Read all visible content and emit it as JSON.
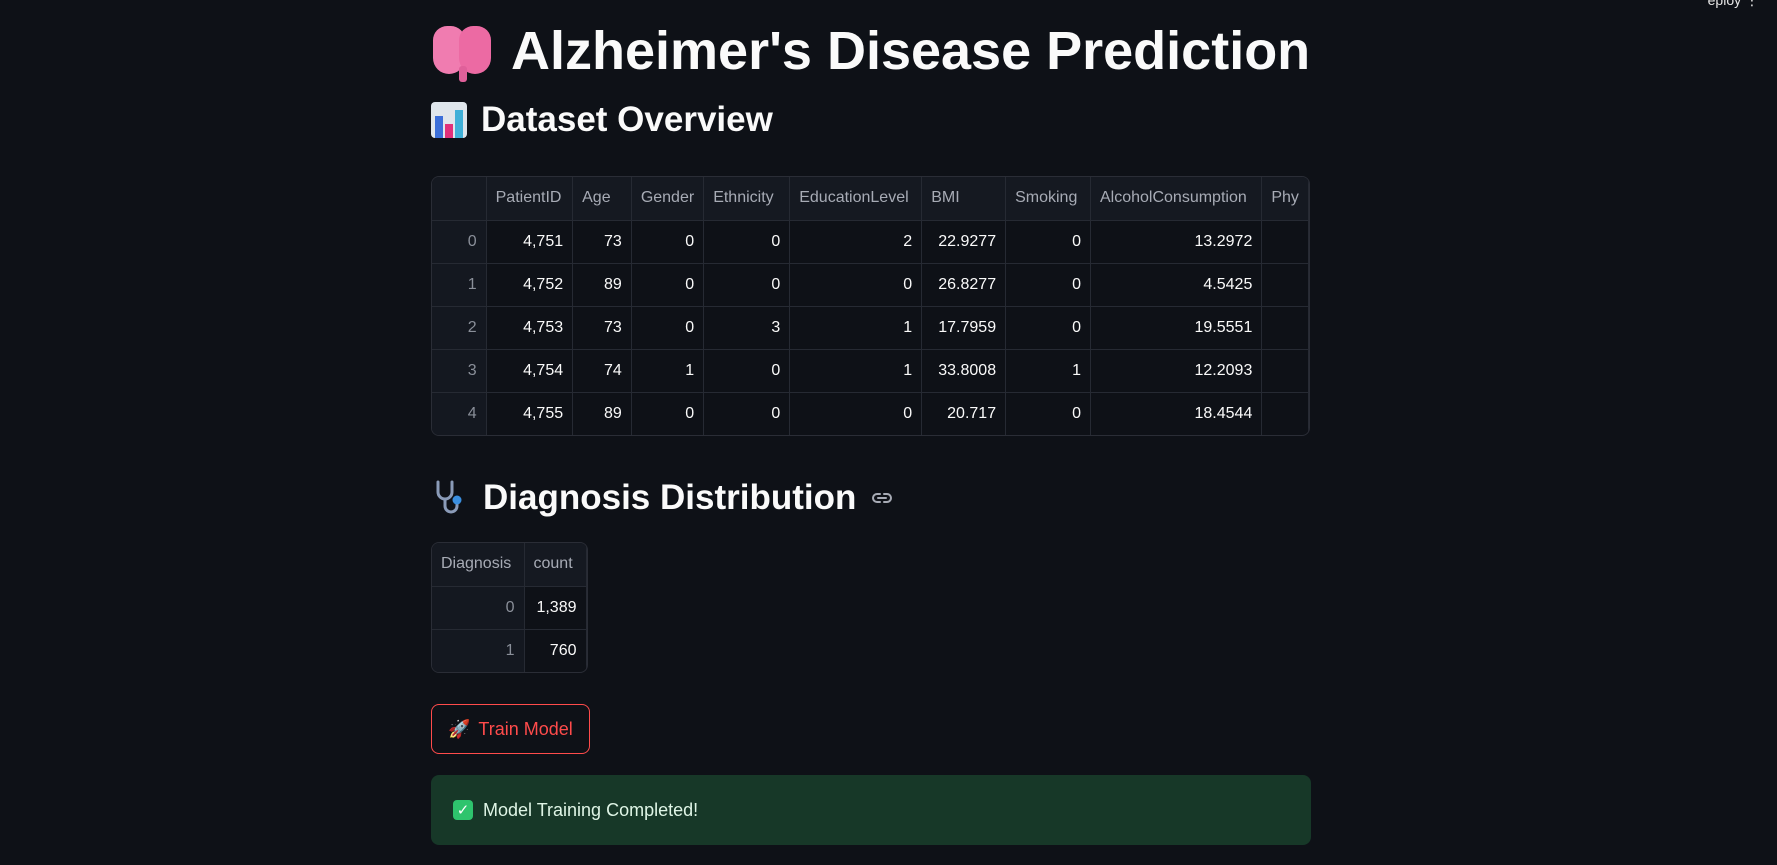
{
  "top_right_fragment": "eploy ⋮",
  "title": "Alzheimer's Disease Prediction",
  "title_icon": "brain-icon",
  "dataset_section": {
    "heading": "Dataset Overview",
    "icon": "bar-chart-icon",
    "columns": [
      "",
      "PatientID",
      "Age",
      "Gender",
      "Ethnicity",
      "EducationLevel",
      "BMI",
      "Smoking",
      "AlcoholConsumption",
      "Phy"
    ],
    "rows": [
      [
        "0",
        "4,751",
        "73",
        "0",
        "0",
        "2",
        "22.9277",
        "0",
        "13.2972",
        ""
      ],
      [
        "1",
        "4,752",
        "89",
        "0",
        "0",
        "0",
        "26.8277",
        "0",
        "4.5425",
        ""
      ],
      [
        "2",
        "4,753",
        "73",
        "0",
        "3",
        "1",
        "17.7959",
        "0",
        "19.5551",
        ""
      ],
      [
        "3",
        "4,754",
        "74",
        "1",
        "0",
        "1",
        "33.8008",
        "1",
        "12.2093",
        ""
      ],
      [
        "4",
        "4,755",
        "89",
        "0",
        "0",
        "0",
        "20.717",
        "0",
        "18.4544",
        ""
      ]
    ]
  },
  "diagnosis_section": {
    "heading": "Diagnosis Distribution",
    "icon": "stethoscope-icon",
    "link_icon": "link-icon",
    "columns": [
      "Diagnosis",
      "count"
    ],
    "rows": [
      [
        "0",
        "1,389"
      ],
      [
        "1",
        "760"
      ]
    ]
  },
  "train_button": {
    "label": "Train Model",
    "icon": "rocket-icon"
  },
  "success": {
    "message": "Model Training Completed!",
    "icon": "check-icon",
    "color": "#173828"
  },
  "colors": {
    "background": "#0e1117",
    "accent": "#ff4b4b"
  }
}
